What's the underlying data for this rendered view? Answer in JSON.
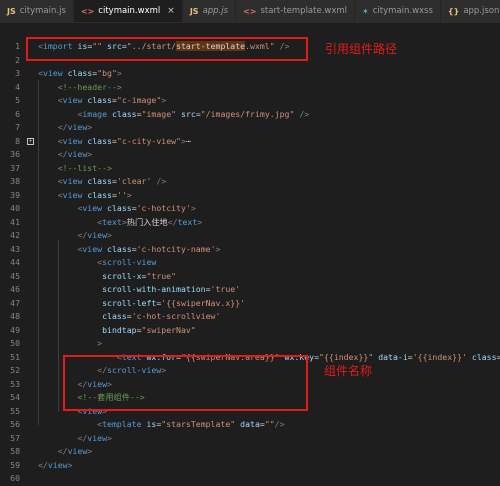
{
  "tabs": [
    {
      "icon": "JS",
      "label": "citymain.js",
      "active": false,
      "italic": false,
      "color": "#e5c07b"
    },
    {
      "icon": "<>",
      "label": "citymain.wxml",
      "active": true,
      "italic": false,
      "color": "#e06c75",
      "close": "×"
    },
    {
      "icon": "JS",
      "label": "app.js",
      "active": false,
      "italic": true,
      "color": "#e5c07b"
    },
    {
      "icon": "<>",
      "label": "start-template.wxml",
      "active": false,
      "italic": false,
      "color": "#e06c75"
    },
    {
      "icon": "✶",
      "label": "citymain.wxss",
      "active": false,
      "italic": false,
      "color": "#56b6c2"
    },
    {
      "icon": "{}",
      "label": "app.json",
      "active": false,
      "italic": false,
      "color": "#e5c07b"
    }
  ],
  "annotations": {
    "import_note": "引用组件路径",
    "name_note": "组件名称"
  },
  "code_lines": [
    {
      "num": "1",
      "parts": [
        [
          "p",
          "<"
        ],
        [
          "t",
          "import"
        ],
        [
          "x",
          " "
        ],
        [
          "a",
          "is"
        ],
        [
          "x",
          "="
        ],
        [
          "s",
          "\"\""
        ],
        [
          "x",
          " "
        ],
        [
          "a",
          "src"
        ],
        [
          "x",
          "="
        ],
        [
          "s",
          "\"../start/"
        ],
        [
          "sel",
          "start-template"
        ],
        [
          "s",
          ".wxml\""
        ],
        [
          "x",
          " "
        ],
        [
          "p",
          "/>"
        ]
      ]
    },
    {
      "num": "2",
      "parts": []
    },
    {
      "num": "3",
      "parts": [
        [
          "p",
          "<"
        ],
        [
          "t",
          "view"
        ],
        [
          "x",
          " "
        ],
        [
          "a",
          "class"
        ],
        [
          "x",
          "="
        ],
        [
          "s",
          "\"bg\""
        ],
        [
          "p",
          ">"
        ]
      ]
    },
    {
      "num": "4",
      "parts": [
        [
          "x",
          "    "
        ],
        [
          "c",
          "<!--header-->"
        ]
      ]
    },
    {
      "num": "5",
      "parts": [
        [
          "x",
          "    "
        ],
        [
          "p",
          "<"
        ],
        [
          "t",
          "view"
        ],
        [
          "x",
          " "
        ],
        [
          "a",
          "class"
        ],
        [
          "x",
          "="
        ],
        [
          "s",
          "\"c-image\""
        ],
        [
          "p",
          ">"
        ]
      ]
    },
    {
      "num": "6",
      "parts": [
        [
          "x",
          "        "
        ],
        [
          "p",
          "<"
        ],
        [
          "t",
          "image"
        ],
        [
          "x",
          " "
        ],
        [
          "a",
          "class"
        ],
        [
          "x",
          "="
        ],
        [
          "s",
          "\"image\""
        ],
        [
          "x",
          " "
        ],
        [
          "a",
          "src"
        ],
        [
          "x",
          "="
        ],
        [
          "s",
          "\"/images/frimy.jpg\""
        ],
        [
          "x",
          " "
        ],
        [
          "p",
          "/>"
        ]
      ]
    },
    {
      "num": "7",
      "parts": [
        [
          "x",
          "    "
        ],
        [
          "p",
          "</"
        ],
        [
          "t",
          "view"
        ],
        [
          "p",
          ">"
        ]
      ]
    },
    {
      "num": "8",
      "fold": "+",
      "parts": [
        [
          "x",
          "    "
        ],
        [
          "p",
          "<"
        ],
        [
          "t",
          "view"
        ],
        [
          "x",
          " "
        ],
        [
          "a",
          "class"
        ],
        [
          "x",
          "="
        ],
        [
          "s",
          "\"c-city-view\""
        ],
        [
          "p",
          ">"
        ],
        [
          "x",
          "⋯"
        ]
      ]
    },
    {
      "num": "36",
      "parts": [
        [
          "x",
          "    "
        ],
        [
          "p",
          "</"
        ],
        [
          "t",
          "view"
        ],
        [
          "p",
          ">"
        ]
      ]
    },
    {
      "num": "37",
      "parts": [
        [
          "x",
          "    "
        ],
        [
          "c",
          "<!--list-->"
        ]
      ]
    },
    {
      "num": "38",
      "parts": [
        [
          "x",
          "    "
        ],
        [
          "p",
          "<"
        ],
        [
          "t",
          "view"
        ],
        [
          "x",
          " "
        ],
        [
          "a",
          "class"
        ],
        [
          "x",
          "="
        ],
        [
          "s",
          "'clear'"
        ],
        [
          "x",
          " "
        ],
        [
          "p",
          "/>"
        ]
      ]
    },
    {
      "num": "39",
      "parts": [
        [
          "x",
          "    "
        ],
        [
          "p",
          "<"
        ],
        [
          "t",
          "view"
        ],
        [
          "x",
          " "
        ],
        [
          "a",
          "class"
        ],
        [
          "x",
          "="
        ],
        [
          "s",
          "''"
        ],
        [
          "p",
          ">"
        ]
      ]
    },
    {
      "num": "40",
      "parts": [
        [
          "x",
          "        "
        ],
        [
          "p",
          "<"
        ],
        [
          "t",
          "view"
        ],
        [
          "x",
          " "
        ],
        [
          "a",
          "class"
        ],
        [
          "x",
          "="
        ],
        [
          "s",
          "'c-hotcity'"
        ],
        [
          "p",
          ">"
        ]
      ]
    },
    {
      "num": "41",
      "parts": [
        [
          "x",
          "            "
        ],
        [
          "p",
          "<"
        ],
        [
          "t",
          "text"
        ],
        [
          "p",
          ">"
        ],
        [
          "x",
          "热门入住地"
        ],
        [
          "p",
          "</"
        ],
        [
          "t",
          "text"
        ],
        [
          "p",
          ">"
        ]
      ]
    },
    {
      "num": "42",
      "parts": [
        [
          "x",
          "        "
        ],
        [
          "p",
          "</"
        ],
        [
          "t",
          "view"
        ],
        [
          "p",
          ">"
        ]
      ]
    },
    {
      "num": "43",
      "parts": [
        [
          "x",
          "        "
        ],
        [
          "p",
          "<"
        ],
        [
          "t",
          "view"
        ],
        [
          "x",
          " "
        ],
        [
          "a",
          "class"
        ],
        [
          "x",
          "="
        ],
        [
          "s",
          "'c-hotcity-name'"
        ],
        [
          "p",
          ">"
        ]
      ]
    },
    {
      "num": "44",
      "parts": [
        [
          "x",
          "            "
        ],
        [
          "p",
          "<"
        ],
        [
          "t",
          "scroll-view"
        ]
      ]
    },
    {
      "num": "45",
      "parts": [
        [
          "x",
          "             "
        ],
        [
          "a",
          "scroll-x"
        ],
        [
          "x",
          "="
        ],
        [
          "s",
          "\"true\""
        ]
      ]
    },
    {
      "num": "46",
      "parts": [
        [
          "x",
          "             "
        ],
        [
          "a",
          "scroll-with-animation"
        ],
        [
          "x",
          "="
        ],
        [
          "s",
          "'true'"
        ]
      ]
    },
    {
      "num": "47",
      "parts": [
        [
          "x",
          "             "
        ],
        [
          "a",
          "scroll-left"
        ],
        [
          "x",
          "="
        ],
        [
          "s",
          "'{{swiperNav.x}}'"
        ]
      ]
    },
    {
      "num": "48",
      "parts": [
        [
          "x",
          "             "
        ],
        [
          "a",
          "class"
        ],
        [
          "x",
          "="
        ],
        [
          "s",
          "'c-hot-scrollview'"
        ]
      ]
    },
    {
      "num": "49",
      "parts": [
        [
          "x",
          "             "
        ],
        [
          "a",
          "bindtap"
        ],
        [
          "x",
          "="
        ],
        [
          "s",
          "\"swiperNav\""
        ]
      ]
    },
    {
      "num": "50",
      "parts": [
        [
          "x",
          "            "
        ],
        [
          "p",
          ">"
        ]
      ]
    },
    {
      "num": "51",
      "parts": [
        [
          "x",
          "                "
        ],
        [
          "p",
          "<"
        ],
        [
          "t",
          "text"
        ],
        [
          "x",
          " "
        ],
        [
          "a",
          "wx:for"
        ],
        [
          "x",
          "="
        ],
        [
          "s",
          "\"{{swiperNav.area}}\""
        ],
        [
          "x",
          " "
        ],
        [
          "a",
          "wx:key"
        ],
        [
          "x",
          "="
        ],
        [
          "s",
          "\"{{index}}\""
        ],
        [
          "x",
          " "
        ],
        [
          "a",
          "data-i"
        ],
        [
          "x",
          "="
        ],
        [
          "s",
          "'{{index}}'"
        ],
        [
          "x",
          " "
        ],
        [
          "a",
          "class"
        ],
        [
          "x",
          "="
        ]
      ]
    },
    {
      "num": "52",
      "parts": [
        [
          "x",
          "            "
        ],
        [
          "p",
          "</"
        ],
        [
          "t",
          "scroll-view"
        ],
        [
          "p",
          ">"
        ]
      ]
    },
    {
      "num": "53",
      "parts": [
        [
          "x",
          "        "
        ],
        [
          "p",
          "</"
        ],
        [
          "t",
          "view"
        ],
        [
          "p",
          ">"
        ]
      ]
    },
    {
      "num": "54",
      "parts": [
        [
          "x",
          "        "
        ],
        [
          "c",
          "<!--套用组件-->"
        ]
      ]
    },
    {
      "num": "55",
      "parts": [
        [
          "x",
          "        "
        ],
        [
          "p",
          "<"
        ],
        [
          "t",
          "view"
        ],
        [
          "p",
          ">"
        ]
      ]
    },
    {
      "num": "56",
      "parts": [
        [
          "x",
          "            "
        ],
        [
          "p",
          "<"
        ],
        [
          "t",
          "template"
        ],
        [
          "x",
          " "
        ],
        [
          "a",
          "is"
        ],
        [
          "x",
          "="
        ],
        [
          "s",
          "\"starsTemplate\""
        ],
        [
          "x",
          " "
        ],
        [
          "a",
          "data"
        ],
        [
          "x",
          "="
        ],
        [
          "s",
          "\"\""
        ],
        [
          "p",
          "/>"
        ]
      ]
    },
    {
      "num": "57",
      "parts": [
        [
          "x",
          "        "
        ],
        [
          "p",
          "</"
        ],
        [
          "t",
          "view"
        ],
        [
          "p",
          ">"
        ]
      ]
    },
    {
      "num": "58",
      "parts": [
        [
          "x",
          "    "
        ],
        [
          "p",
          "</"
        ],
        [
          "t",
          "view"
        ],
        [
          "p",
          ">"
        ]
      ]
    },
    {
      "num": "59",
      "parts": [
        [
          "p",
          "</"
        ],
        [
          "t",
          "view"
        ],
        [
          "p",
          ">"
        ]
      ]
    },
    {
      "num": "60",
      "parts": []
    }
  ]
}
